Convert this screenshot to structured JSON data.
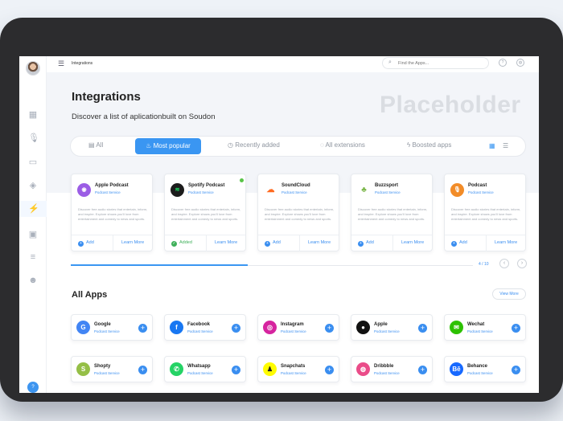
{
  "topbar": {
    "crumb": "Integrations",
    "search_placeholder": "Find the Apps..."
  },
  "hero": {
    "title": "Integrations",
    "subtitle": "Discover a list of aplicationbuilt on Soudon",
    "watermark": "Placeholder"
  },
  "tabs": [
    "All",
    "Most popular",
    "Recently added",
    "All extensions",
    "Boosted apps"
  ],
  "active_tab": "Most popular",
  "featured": [
    {
      "name": "Apple Podcast",
      "service": "Podcast Service",
      "desc": "Discover free audio stories that entertain, inform, and inspire. Explore shows you'll love from entertainment and comedy to news and sports.",
      "action": "Add",
      "learn": "Learn More",
      "color": "#9b5de5",
      "icon": "podcast-icon"
    },
    {
      "name": "Spotify Podcast",
      "service": "Podcast Service",
      "desc": "Discover free audio stories that entertain, inform, and inspire. Explore shows you'll love from entertainment and comedy to news and sports.",
      "action": "Added",
      "learn": "Learn More",
      "color": "#1c1c1c",
      "icon": "spotify-icon"
    },
    {
      "name": "SoundCloud",
      "service": "Podcast Service",
      "desc": "Discover free audio stories that entertain, inform, and inspire. Explore shows you'll love from entertainment and comedy to news and sports.",
      "action": "Add",
      "learn": "Learn More",
      "color": "#ff6a1f",
      "icon": "soundcloud-icon"
    },
    {
      "name": "Buzzsport",
      "service": "Podcast Service",
      "desc": "Discover free audio stories that entertain, inform, and inspire. Explore shows you'll love from entertainment and comedy to news and sports.",
      "action": "Add",
      "learn": "Learn More",
      "color": "#7ab648",
      "icon": "buzzsport-icon"
    },
    {
      "name": "Podcast",
      "service": "Podcast Service",
      "desc": "Discover free audio stories that entertain, inform, and inspire. Explore shows you'll love from entertainment and comedy to news and sports.",
      "action": "Add",
      "learn": "Learn More",
      "color": "#f28c28",
      "icon": "microphone-icon"
    }
  ],
  "pager": "4 / 10",
  "carousel_progress": 0.44,
  "all_apps_title": "All Apps",
  "view_more": "View More",
  "apps": [
    {
      "name": "Google",
      "service": "Podcast Service",
      "color": "#4285f4",
      "glyph": "G"
    },
    {
      "name": "Facebook",
      "service": "Podcast Service",
      "color": "#1877f2",
      "glyph": "f"
    },
    {
      "name": "Instagram",
      "service": "Podcast Service",
      "color": "#d6249f",
      "glyph": "◎"
    },
    {
      "name": "Apple",
      "service": "Podcast Service",
      "color": "#111111",
      "glyph": "●"
    },
    {
      "name": "Wechat",
      "service": "Podcast Service",
      "color": "#2dc100",
      "glyph": "✉"
    },
    {
      "name": "Shopty",
      "service": "Podcast Service",
      "color": "#95bf47",
      "glyph": "S"
    },
    {
      "name": "Whatsapp",
      "service": "Podcast Service",
      "color": "#25d366",
      "glyph": "✆"
    },
    {
      "name": "Snapchats",
      "service": "Podcast Service",
      "color": "#fffc00",
      "glyph": "♟"
    },
    {
      "name": "Dribbble",
      "service": "Podcast Service",
      "color": "#ea4c89",
      "glyph": "◍"
    },
    {
      "name": "Behance",
      "service": "Podcast Service",
      "color": "#1769ff",
      "glyph": "Bē"
    }
  ],
  "help_label": "?"
}
